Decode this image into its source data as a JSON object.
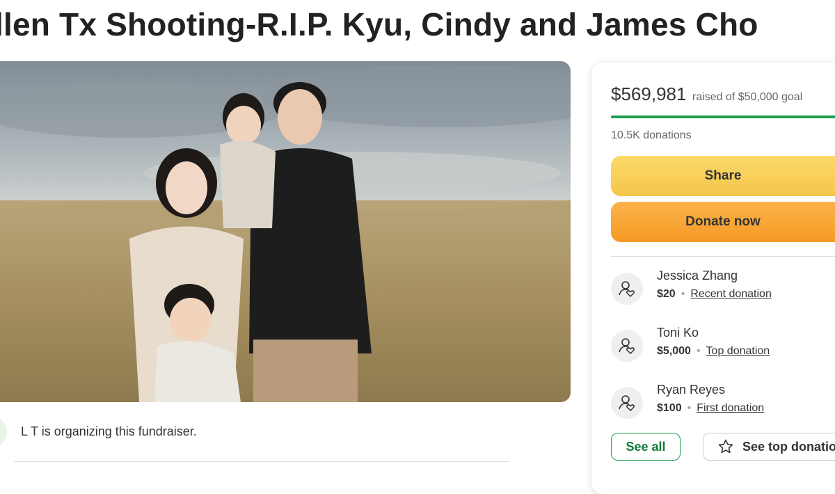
{
  "campaign": {
    "title": "llen Tx Shooting-R.I.P. Kyu, Cindy and James Cho",
    "organizer_text": "L T is organizing this fundraiser."
  },
  "donation_card": {
    "amount_raised": "$569,981",
    "goal_text": "raised of $50,000 goal",
    "progress": 1.0,
    "donations_count": "10.5K donations",
    "share_label": "Share",
    "donate_label": "Donate now",
    "donors": [
      {
        "name": "Jessica Zhang",
        "amount": "$20",
        "tag": "Recent donation"
      },
      {
        "name": "Toni Ko",
        "amount": "$5,000",
        "tag": "Top donation"
      },
      {
        "name": "Ryan Reyes",
        "amount": "$100",
        "tag": "First donation"
      }
    ],
    "see_all_label": "See all",
    "see_top_label": "See top donations"
  },
  "icons": {
    "donor": "donor-heart-icon",
    "star": "star-icon"
  },
  "colors": {
    "progress": "#1d9d50",
    "share_button": "#f4c64a",
    "donate_button": "#f59b25",
    "see_all_border": "#1d9d50"
  }
}
